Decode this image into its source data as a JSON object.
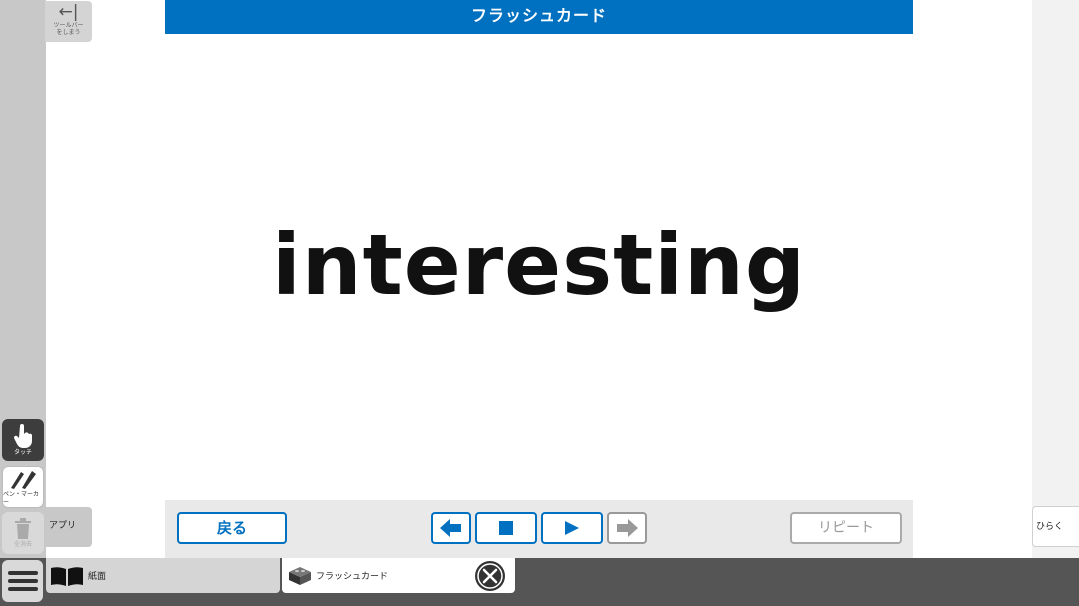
{
  "toolbar": {
    "close_label": "ツールバー\nをしまう",
    "close_arrow": "←|",
    "touch_label": "タッチ",
    "pen_label": "ペン・マーカー",
    "clear_label": "全消去",
    "apps_label": "アプリ",
    "open_label": "ひらく"
  },
  "app": {
    "title": "フラッシュカード",
    "word": "interesting",
    "back_label": "戻る",
    "repeat_label": "リピート"
  },
  "taskbar": {
    "tabs": [
      {
        "label": "紙面",
        "icon": "book-icon"
      },
      {
        "label": "フラッシュカード",
        "icon": "block-icon"
      }
    ]
  },
  "colors": {
    "accent": "#0070c0",
    "taskbar": "#555555",
    "sidebar": "#c8c8c8"
  }
}
